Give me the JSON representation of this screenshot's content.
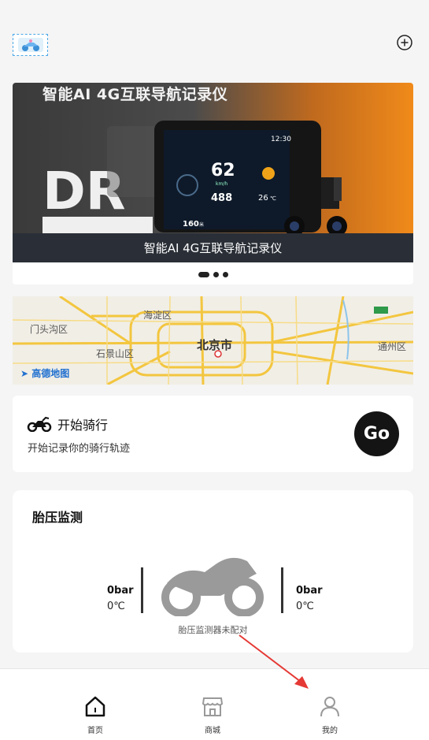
{
  "header": {
    "add_icon": "plus-circle-icon",
    "logo_icon": "motorcycle-logo-icon"
  },
  "banner": {
    "headline": "智能AI 4G互联导航记录仪",
    "caption": "智能AI 4G互联导航记录仪",
    "device": {
      "time": "12:30",
      "speed": "62",
      "speed_unit": "km/h",
      "distance": "488",
      "temp": "26",
      "temp_unit": "℃",
      "nav_distance": "160",
      "nav_distance_unit": "米"
    },
    "slide_count": 3,
    "active_slide": 1
  },
  "map": {
    "labels": [
      "海淀区",
      "门头沟区",
      "石景山区",
      "北京市",
      "通州区"
    ],
    "brand": "高德地图"
  },
  "ride": {
    "title": "开始骑行",
    "subtitle": "开始记录你的骑行轨迹",
    "go_label": "Go"
  },
  "tire": {
    "title": "胎压监测",
    "left": {
      "pressure": "0bar",
      "temp": "0℃"
    },
    "right": {
      "pressure": "0bar",
      "temp": "0℃"
    },
    "status": "胎压监测器未配对"
  },
  "nav": {
    "items": [
      {
        "label": "首页",
        "icon": "home-icon"
      },
      {
        "label": "商城",
        "icon": "store-icon"
      },
      {
        "label": "我的",
        "icon": "user-icon"
      }
    ]
  },
  "colors": {
    "accent_orange": "#f08a1a",
    "caption_bg": "#2a2f37",
    "map_road": "#f5c842",
    "arrow": "#e53935"
  }
}
